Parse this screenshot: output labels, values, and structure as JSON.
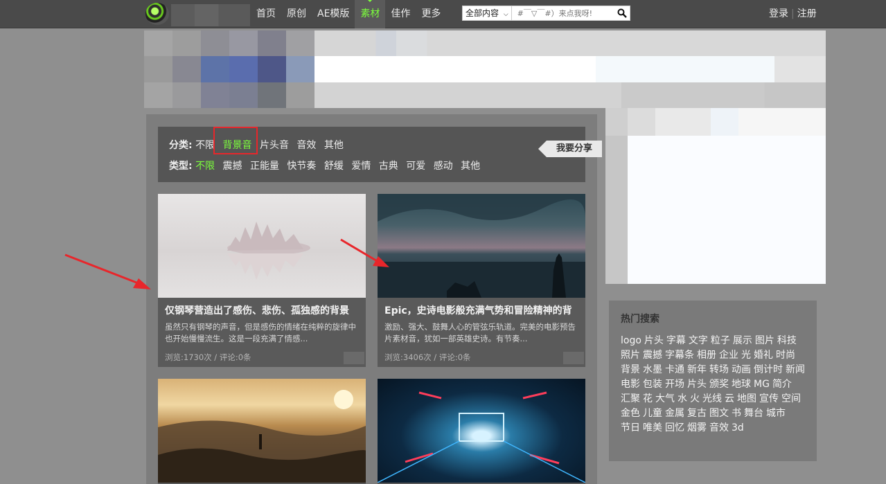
{
  "nav": {
    "items": [
      {
        "label": "首页",
        "active": false
      },
      {
        "label": "原创",
        "active": false
      },
      {
        "label": "AE模版",
        "active": false
      },
      {
        "label": "素材",
        "active": true
      },
      {
        "label": "佳作",
        "active": false
      },
      {
        "label": "更多",
        "active": false
      }
    ],
    "search": {
      "scope": "全部内容",
      "placeholder": "#￣▽￣#）来点我呀!"
    },
    "login": "登录",
    "register": "注册"
  },
  "filters": {
    "category_label": "分类:",
    "categories": [
      {
        "label": "不限",
        "on": false
      },
      {
        "label": "背景音",
        "on": true
      },
      {
        "label": "片头音",
        "on": false
      },
      {
        "label": "音效",
        "on": false
      },
      {
        "label": "其他",
        "on": false
      }
    ],
    "type_label": "类型:",
    "types": [
      {
        "label": "不限",
        "on": true
      },
      {
        "label": "震撼",
        "on": false
      },
      {
        "label": "正能量",
        "on": false
      },
      {
        "label": "快节奏",
        "on": false
      },
      {
        "label": "舒缓",
        "on": false
      },
      {
        "label": "爱情",
        "on": false
      },
      {
        "label": "古典",
        "on": false
      },
      {
        "label": "可爱",
        "on": false
      },
      {
        "label": "感动",
        "on": false
      },
      {
        "label": "其他",
        "on": false
      }
    ],
    "share": "我要分享"
  },
  "cards": [
    {
      "title": "仅钢琴营造出了感伤、悲伤、孤独感的背景",
      "desc": "虽然只有钢琴的声音，但是感伤的情绪在纯粹的旋律中也开始慢慢流生。这是一段充满了情感...",
      "meta": "浏览:1730次 / 评论:0条"
    },
    {
      "title": "Epic，史诗电影般充满气势和冒险精神的背",
      "desc": "激励、强大、鼓舞人心的管弦乐轨道。完美的电影预告片素材音，犹如一部英雄史诗。有节奏...",
      "meta": "浏览:3406次 / 评论:0条"
    },
    {
      "title": "",
      "desc": "",
      "meta": ""
    },
    {
      "title": "",
      "desc": "",
      "meta": ""
    }
  ],
  "hot": {
    "title": "热门搜索",
    "tags": [
      "logo",
      "片头",
      "字幕",
      "文字",
      "粒子",
      "展示",
      "图片",
      "科技",
      "照片",
      "震撼",
      "字幕条",
      "相册",
      "企业",
      "光",
      "婚礼",
      "时尚",
      "背景",
      "水墨",
      "卡通",
      "新年",
      "转场",
      "动画",
      "倒计时",
      "新闻",
      "电影",
      "包装",
      "开场",
      "片头",
      "颁奖",
      "地球",
      "MG",
      "简介",
      "汇聚",
      "花",
      "大气",
      "水",
      "火",
      "光线",
      "云",
      "地图",
      "宣传",
      "空间",
      "金色",
      "儿童",
      "金属",
      "复古",
      "图文",
      "书",
      "舞台",
      "城市",
      "节日",
      "唯美",
      "回忆",
      "烟雾",
      "音效",
      "3d"
    ]
  },
  "colors": {
    "accent": "#7cff3c",
    "annotation": "#e8262b"
  }
}
